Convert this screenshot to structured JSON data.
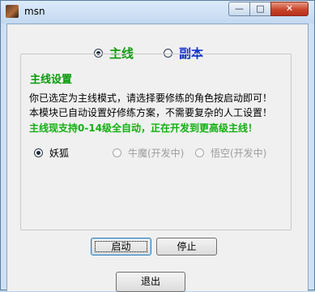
{
  "window": {
    "title": "msn",
    "controls": {
      "minimize": "—",
      "maximize": "□",
      "close": "✕"
    }
  },
  "mode": {
    "options": [
      {
        "label": "主线",
        "selected": true
      },
      {
        "label": "副本",
        "selected": false
      }
    ]
  },
  "group": {
    "title": "主线设置",
    "lines": [
      "你已选定为主线模式，请选择要修练的角色按启动即可！",
      "本模块已自动设置好修练方案，不需要复杂的人工设置！"
    ],
    "highlight": "主线现支持0-14级全自动，正在开发到更高级主线！",
    "characters": [
      {
        "label": "妖狐",
        "selected": true,
        "enabled": true
      },
      {
        "label": "牛魔(开发中)",
        "selected": false,
        "enabled": false
      },
      {
        "label": "悟空(开发中)",
        "selected": false,
        "enabled": false
      }
    ]
  },
  "buttons": {
    "start": "启动",
    "stop": "停止",
    "exit": "退出"
  },
  "colors": {
    "green": "#0a9a0a",
    "blue": "#1232c8"
  }
}
